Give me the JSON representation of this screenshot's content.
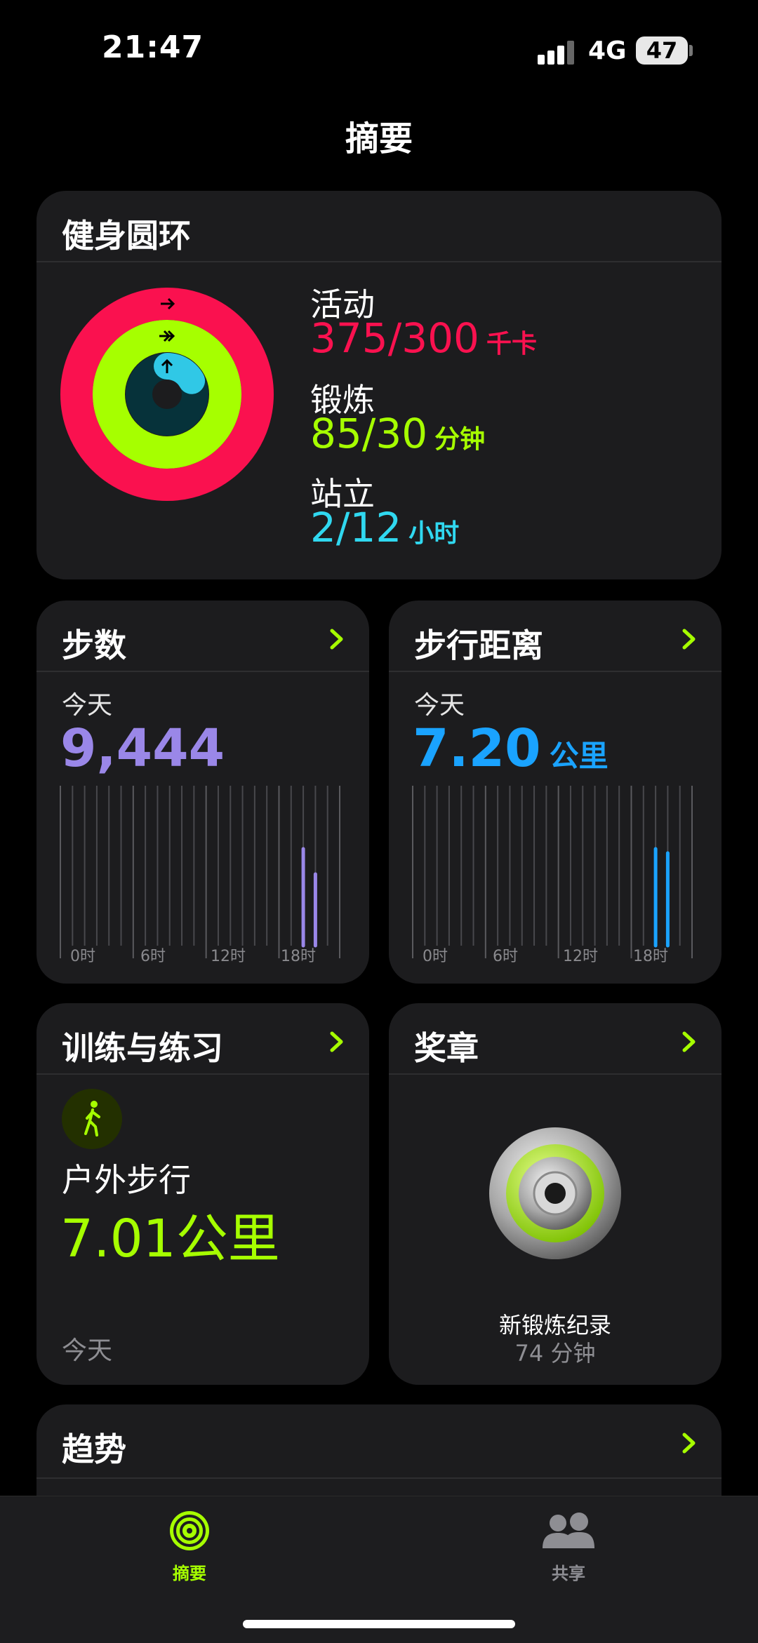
{
  "status_bar": {
    "time": "21:47",
    "network": "4G",
    "battery": "47"
  },
  "page_title": "摘要",
  "rings_card": {
    "title": "健身圆环",
    "move": {
      "label": "活动",
      "value": "375/300",
      "unit": "千卡",
      "color": "#fa114f"
    },
    "exercise": {
      "label": "锻炼",
      "value": "85/30",
      "unit": "分钟",
      "color": "#a6ff00"
    },
    "stand": {
      "label": "站立",
      "value": "2/12",
      "unit": "小时",
      "color": "#00d8ff"
    },
    "progress": {
      "move": 1.25,
      "exercise": 2.83,
      "stand": 0.17
    }
  },
  "steps_card": {
    "title": "步数",
    "today_label": "今天",
    "value": "9,444",
    "color": "#9a87e8",
    "axis_ticks": [
      "0时",
      "6时",
      "12时",
      "18时"
    ]
  },
  "distance_card": {
    "title": "步行距离",
    "today_label": "今天",
    "value": "7.20",
    "unit": "公里",
    "color": "#1aa3ff",
    "axis_ticks": [
      "0时",
      "6时",
      "12时",
      "18时"
    ]
  },
  "workouts_card": {
    "title": "训练与练习",
    "workout_name": "户外步行",
    "workout_value": "7.01公里",
    "date_label": "今天",
    "icon": "walking-icon",
    "color": "#a6ff00"
  },
  "awards_card": {
    "title": "奖章",
    "award_name": "新锻炼纪录",
    "award_detail": "74 分钟",
    "icon": "award-medal-icon"
  },
  "trends_card": {
    "title": "趋势"
  },
  "tab_bar": {
    "tabs": [
      {
        "label": "摘要",
        "icon": "rings-icon",
        "active": true,
        "color": "#a6ff00"
      },
      {
        "label": "共享",
        "icon": "people-icon",
        "active": false,
        "color": "#8e8e93"
      }
    ]
  }
}
